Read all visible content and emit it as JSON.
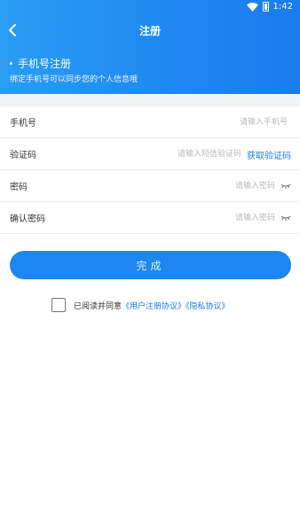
{
  "status_bar": {
    "time": "1:42"
  },
  "header": {
    "title": "注册",
    "heading": "手机号注册",
    "subtitle": "绑定手机号可以同步您的个人信息哦"
  },
  "form": {
    "phone": {
      "label": "手机号",
      "placeholder": "请输入手机号",
      "value": ""
    },
    "code": {
      "label": "验证码",
      "placeholder": "请输入短信验证码",
      "value": "",
      "action": "获取验证码"
    },
    "password": {
      "label": "密码",
      "placeholder": "请输入密码",
      "value": ""
    },
    "confirm_password": {
      "label": "确认密码",
      "placeholder": "请输入密码",
      "value": ""
    }
  },
  "submit_label": "完成",
  "agreement": {
    "prefix": "已阅读并同意",
    "user_agreement": "《用户注册协议》",
    "privacy_policy": "《隐私协议》",
    "checked": false
  },
  "colors": {
    "primary": "#1e86f0",
    "link": "#1a7cee",
    "divider": "#f2f3f5"
  },
  "icons": [
    "back-icon",
    "wifi-icon",
    "battery-icon",
    "eye-closed-icon"
  ]
}
